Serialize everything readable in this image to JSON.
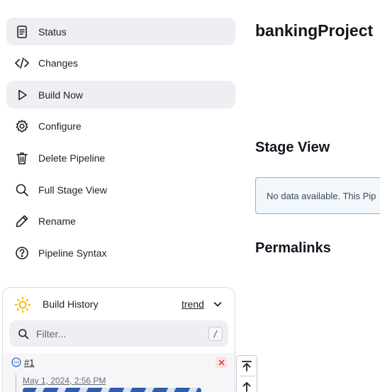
{
  "sidebar": {
    "items": [
      {
        "label": "Status",
        "icon": "document-icon",
        "active": true
      },
      {
        "label": "Changes",
        "icon": "code-icon",
        "active": false
      },
      {
        "label": "Build Now",
        "icon": "play-icon",
        "active": true
      },
      {
        "label": "Configure",
        "icon": "gear-icon",
        "active": false
      },
      {
        "label": "Delete Pipeline",
        "icon": "trash-icon",
        "active": false
      },
      {
        "label": "Full Stage View",
        "icon": "search-icon",
        "active": false
      },
      {
        "label": "Rename",
        "icon": "pencil-icon",
        "active": false
      },
      {
        "label": "Pipeline Syntax",
        "icon": "help-circle-icon",
        "active": false
      }
    ]
  },
  "main": {
    "title": "bankingProject",
    "stage_view_heading": "Stage View",
    "stage_view_notice": "No data available. This Pip",
    "permalinks_heading": "Permalinks"
  },
  "build_history": {
    "title": "Build History",
    "trend_label": "trend",
    "filter_placeholder": "Filter...",
    "filter_shortcut": "/",
    "builds": [
      {
        "number": "#1",
        "date": "May 1, 2024, 2:56 PM",
        "status": "in-progress"
      }
    ]
  },
  "colors": {
    "accent": "#2f5eaa",
    "active_bg": "#eeeef3",
    "sun": "#f5b400",
    "delete": "#e0303d"
  }
}
